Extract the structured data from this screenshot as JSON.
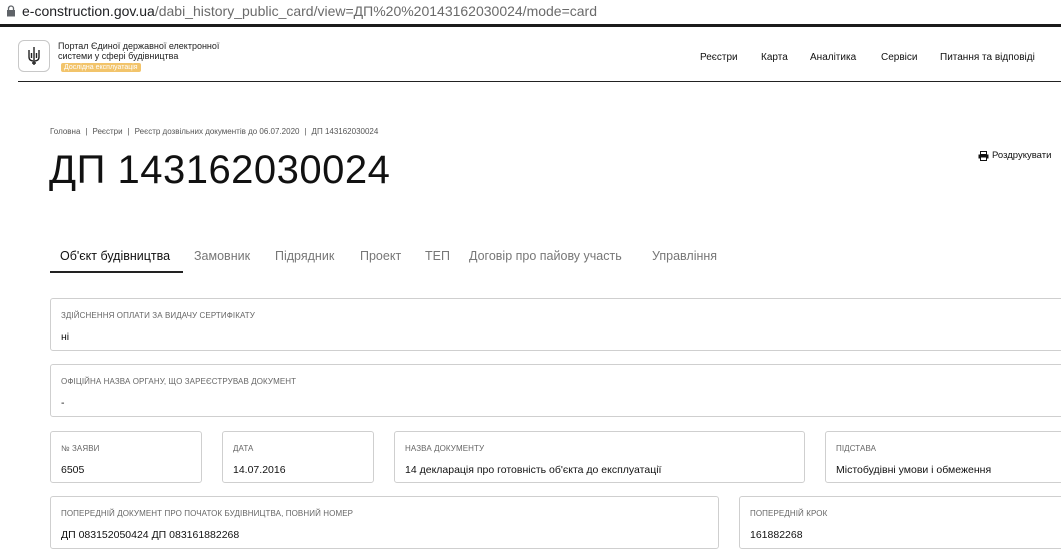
{
  "browser": {
    "url_domain": "e-construction.gov.ua",
    "url_path": "/dabi_history_public_card/view=ДП%20%20143162030024/mode=card"
  },
  "header": {
    "portal_name": "Портал Єдиної державної електронної системи у сфері будівництва",
    "badge": "Дослідна експлуатація",
    "nav": [
      "Реєстри",
      "Карта",
      "Аналітика",
      "Сервіси",
      "Питання та відповіді"
    ]
  },
  "breadcrumb": [
    "Головна",
    "Реєстри",
    "Реєстр дозвільних документів до 06.07.2020",
    "ДП 143162030024"
  ],
  "page": {
    "title": "ДП 143162030024",
    "print_label": "Роздрукувати"
  },
  "tabs": [
    "Об'єкт будівництва",
    "Замовник",
    "Підрядник",
    "Проект",
    "ТЕП",
    "Договір про пайову участь",
    "Управління"
  ],
  "fields": [
    {
      "label": "Здійснення оплати за видачу сертифікату",
      "value": "ні"
    },
    {
      "label": "Офіційна назва органу, що зареєстрував документ",
      "value": "-"
    },
    {
      "label": "№ заяви",
      "value": "6505"
    },
    {
      "label": "Дата",
      "value": "14.07.2016"
    },
    {
      "label": "Назва документу",
      "value": "14 декларація про готовність об'єкта до експлуатації"
    },
    {
      "label": "Підстава",
      "value": "Містобудівні умови і обмеження"
    },
    {
      "label": "Попередній документ про початок будівництва, повний номер",
      "value": "ДП 083152050424 ДП 083161882268"
    },
    {
      "label": "Попередній крок",
      "value": "161882268"
    }
  ]
}
